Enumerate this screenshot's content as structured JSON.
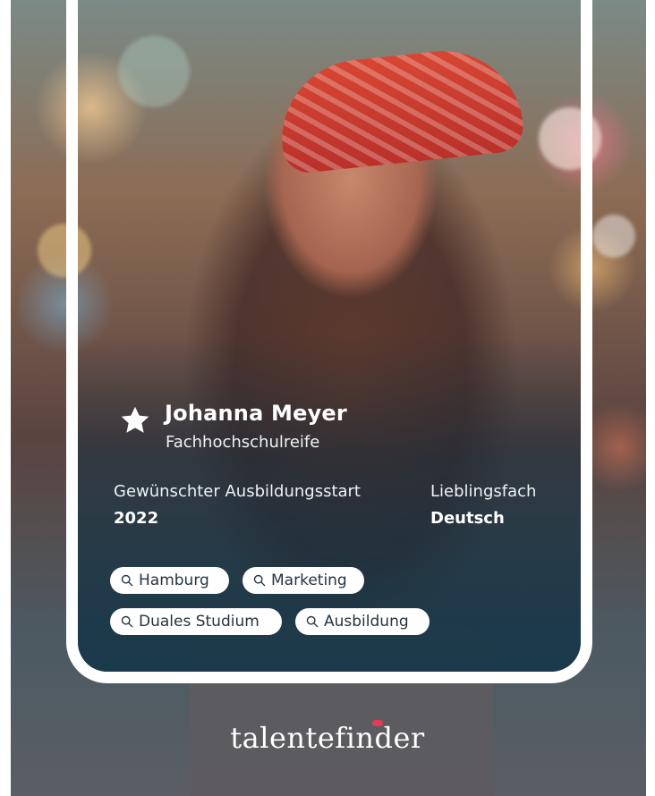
{
  "profile": {
    "name": "Johanna Meyer",
    "school": "Fachhochschulreife",
    "favorite_icon": "star-icon"
  },
  "info": {
    "start_label": "Gewünschter Ausbildungsstart",
    "start_value": "2022",
    "subject_label": "Lieblingsfach",
    "subject_value": "Deutsch"
  },
  "chips": [
    {
      "label": "Hamburg",
      "icon": "search-icon"
    },
    {
      "label": "Marketing",
      "icon": "search-icon"
    },
    {
      "label": "Duales Studium",
      "icon": "search-icon"
    },
    {
      "label": "Ausbildung",
      "icon": "search-icon"
    }
  ],
  "brand": {
    "name": "talentefinder",
    "accent_color": "#e33a55"
  },
  "colors": {
    "card_border": "#ffffff",
    "chip_bg": "#ffffff",
    "chip_text": "#263440"
  }
}
